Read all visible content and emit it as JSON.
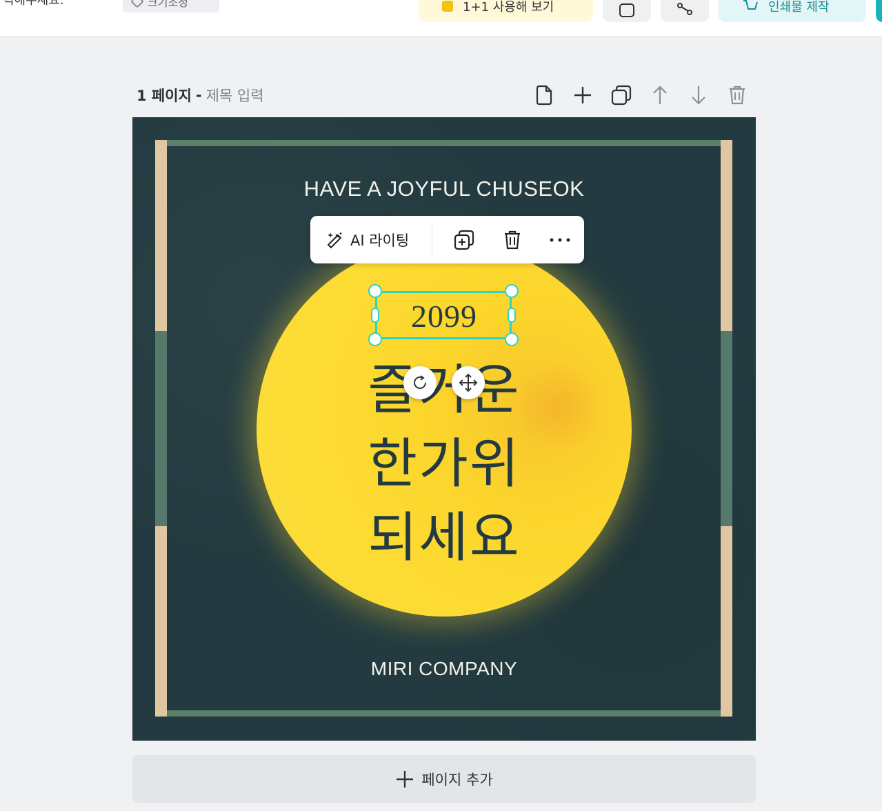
{
  "topbar": {
    "hint_text": "력해주세요.",
    "tag_label": "크기조정",
    "promo_label": "1+1 사용해 보기",
    "print_label": "인쇄물 제작"
  },
  "page": {
    "number_label": "1 페이지",
    "separator": "-",
    "title_placeholder": "제목 입력",
    "tools": [
      "page-icon",
      "plus-icon",
      "duplicate-icon",
      "arrow-up-icon",
      "arrow-down-icon",
      "trash-icon"
    ]
  },
  "canvas": {
    "title": "HAVE A JOYFUL CHUSEOK",
    "year": "2099",
    "lines": [
      "즐거운",
      "한가위",
      "되세요"
    ],
    "company": "MIRI COMPANY",
    "colors": {
      "background": "#233b40",
      "frame_green": "#5a7f6a",
      "frame_beige": "#e1c7a1",
      "moon": "#fddb32",
      "selection": "#2ed3c2"
    }
  },
  "float_toolbar": {
    "ai_label": "AI 라이팅",
    "buttons": [
      "duplicate-icon",
      "trash-icon",
      "more-icon"
    ]
  },
  "add_page": {
    "label": "페이지 추가"
  }
}
